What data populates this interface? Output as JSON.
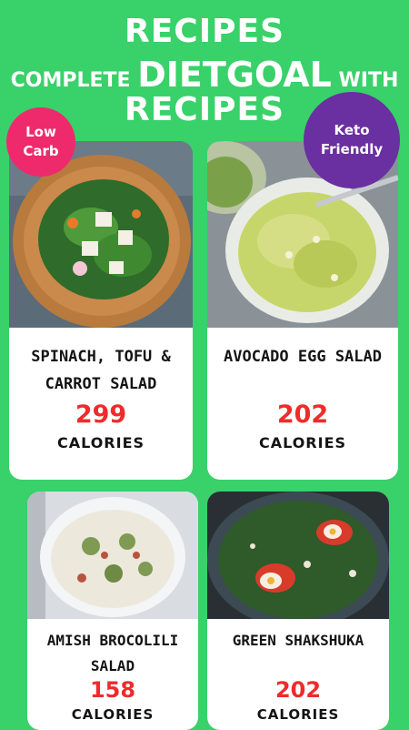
{
  "header": {
    "line1": "RECIPES",
    "line2_pre": "COMPLETE ",
    "line2_big": "DIETGOAL",
    "line2_post": " WITH",
    "line3": "RECIPES"
  },
  "badges": {
    "low_carb": "Low Carb",
    "keto": "Keto Friendly",
    "low_carb_color": "#ee2a6d",
    "keto_color": "#6a2fa0"
  },
  "recipes": [
    {
      "name": "SPINACH, TOFU & CARROT SALAD",
      "calories": "299",
      "unit": "CALORIES"
    },
    {
      "name": "AVOCADO EGG SALAD",
      "calories": "202",
      "unit": "CALORIES"
    },
    {
      "name": "AMISH BROCOLILI SALAD",
      "calories": "158",
      "unit": "CALORIES"
    },
    {
      "name": "GREEN SHAKSHUKA",
      "calories": "202",
      "unit": "CALORIES"
    }
  ],
  "colors": {
    "background": "#39d169",
    "calories": "#ef2b2b"
  }
}
